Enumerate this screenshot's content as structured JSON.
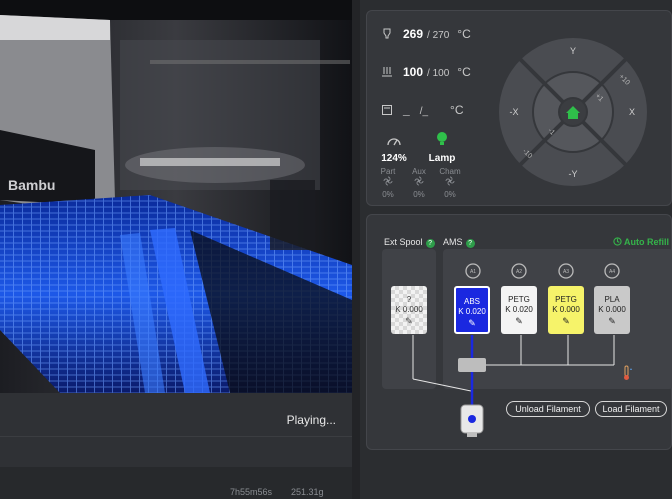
{
  "video": {
    "status": "Playing..."
  },
  "footer": {
    "time": "7h55m56s",
    "weight": "251.31g"
  },
  "temps": {
    "nozzle": {
      "current": "269",
      "target": "/ 270",
      "unit": "°C",
      "icon": "nozzle-icon"
    },
    "bed": {
      "current": "100",
      "target": "/ 100",
      "unit": "°C",
      "icon": "heatbed-icon"
    },
    "chamber": {
      "current": "_",
      "target": "/_",
      "unit": "°C",
      "icon": "chamber-icon"
    }
  },
  "speed": {
    "value": "124%",
    "icon": "speedometer-icon"
  },
  "lamp": {
    "label": "Lamp",
    "icon": "lamp-icon",
    "color": "#2fbf4a"
  },
  "fans": [
    {
      "label": "Part",
      "value": "0%"
    },
    {
      "label": "Aux",
      "value": "0%"
    },
    {
      "label": "Cham",
      "value": "0%"
    }
  ],
  "jog": {
    "up": "Y",
    "down": "-Y",
    "left": "-X",
    "right": "X",
    "plus10": "+10",
    "plus1": "+1",
    "minus1": "-1",
    "minus10": "-10",
    "home_icon": "home-icon"
  },
  "ams": {
    "ext_spool_label": "Ext Spool",
    "ams_label": "AMS",
    "help": "?",
    "auto_refill": "Auto Refill",
    "ext_spool": {
      "name": "?",
      "k": "K 0.000"
    },
    "slots": [
      {
        "name": "ABS",
        "k": "K 0.020",
        "color": "#1a28e0",
        "text": "#ffffff",
        "ring": "A1"
      },
      {
        "name": "PETG",
        "k": "K 0.020",
        "color": "#f4f4f4",
        "text": "#222222",
        "ring": "A2"
      },
      {
        "name": "PETG",
        "k": "K 0.000",
        "color": "#f6f36a",
        "text": "#222222",
        "ring": "A3"
      },
      {
        "name": "PLA",
        "k": "K 0.000",
        "color": "#c9c9c9",
        "text": "#222222",
        "ring": "A4"
      }
    ],
    "unload": "Unload Filament",
    "load": "Load Filament"
  }
}
